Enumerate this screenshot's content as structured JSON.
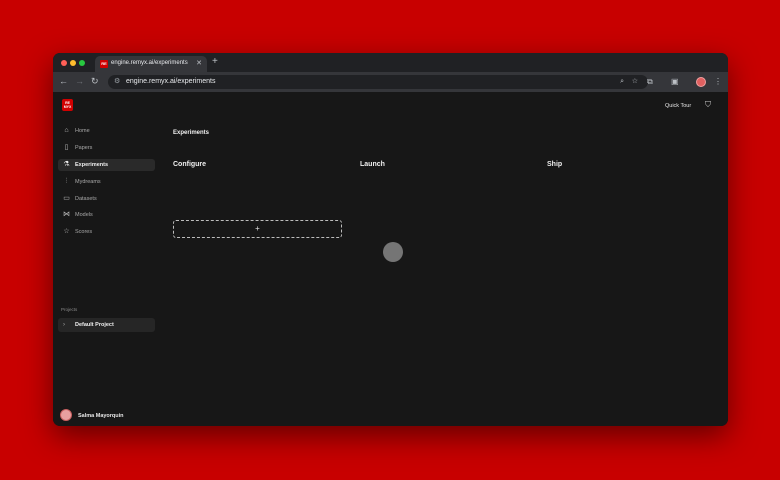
{
  "browser": {
    "tab_title": "engine.remyx.ai/experiments",
    "tab_favicon_text": "RE",
    "tab_close_icon": "close-icon",
    "new_tab_label": "+",
    "url": "engine.remyx.ai/experiments",
    "nav": {
      "back": "←",
      "forward": "→",
      "reload": "↻"
    },
    "icons": [
      "zoom-icon",
      "bookmark-star-icon",
      "extensions-icon",
      "side-panel-icon",
      "profile-avatar",
      "menu-icon"
    ]
  },
  "header": {
    "logo_text": "REMYX",
    "quick_tour_label": "Quick Tour",
    "shirt_icon": "shirt-icon"
  },
  "sidebar": {
    "items": [
      {
        "label": "Home",
        "icon": "home-icon",
        "glyph": "⌂"
      },
      {
        "label": "Papers",
        "icon": "book-icon",
        "glyph": "▯"
      },
      {
        "label": "Experiments",
        "icon": "flask-icon",
        "glyph": "⚗"
      },
      {
        "label": "Mydreams",
        "icon": "sliders-icon",
        "glyph": "⫶"
      },
      {
        "label": "Datasets",
        "icon": "file-icon",
        "glyph": "▭"
      },
      {
        "label": "Models",
        "icon": "network-icon",
        "glyph": "⋈"
      },
      {
        "label": "Scores",
        "icon": "star-icon",
        "glyph": "☆"
      }
    ],
    "active_index": 2,
    "projects_heading": "Projects",
    "project_label": "Default Project",
    "project_chevron": "›"
  },
  "user": {
    "name": "Salma Mayorquin"
  },
  "main": {
    "title": "Experiments",
    "columns": [
      "Configure",
      "Launch",
      "Ship"
    ],
    "add_label": "+"
  }
}
